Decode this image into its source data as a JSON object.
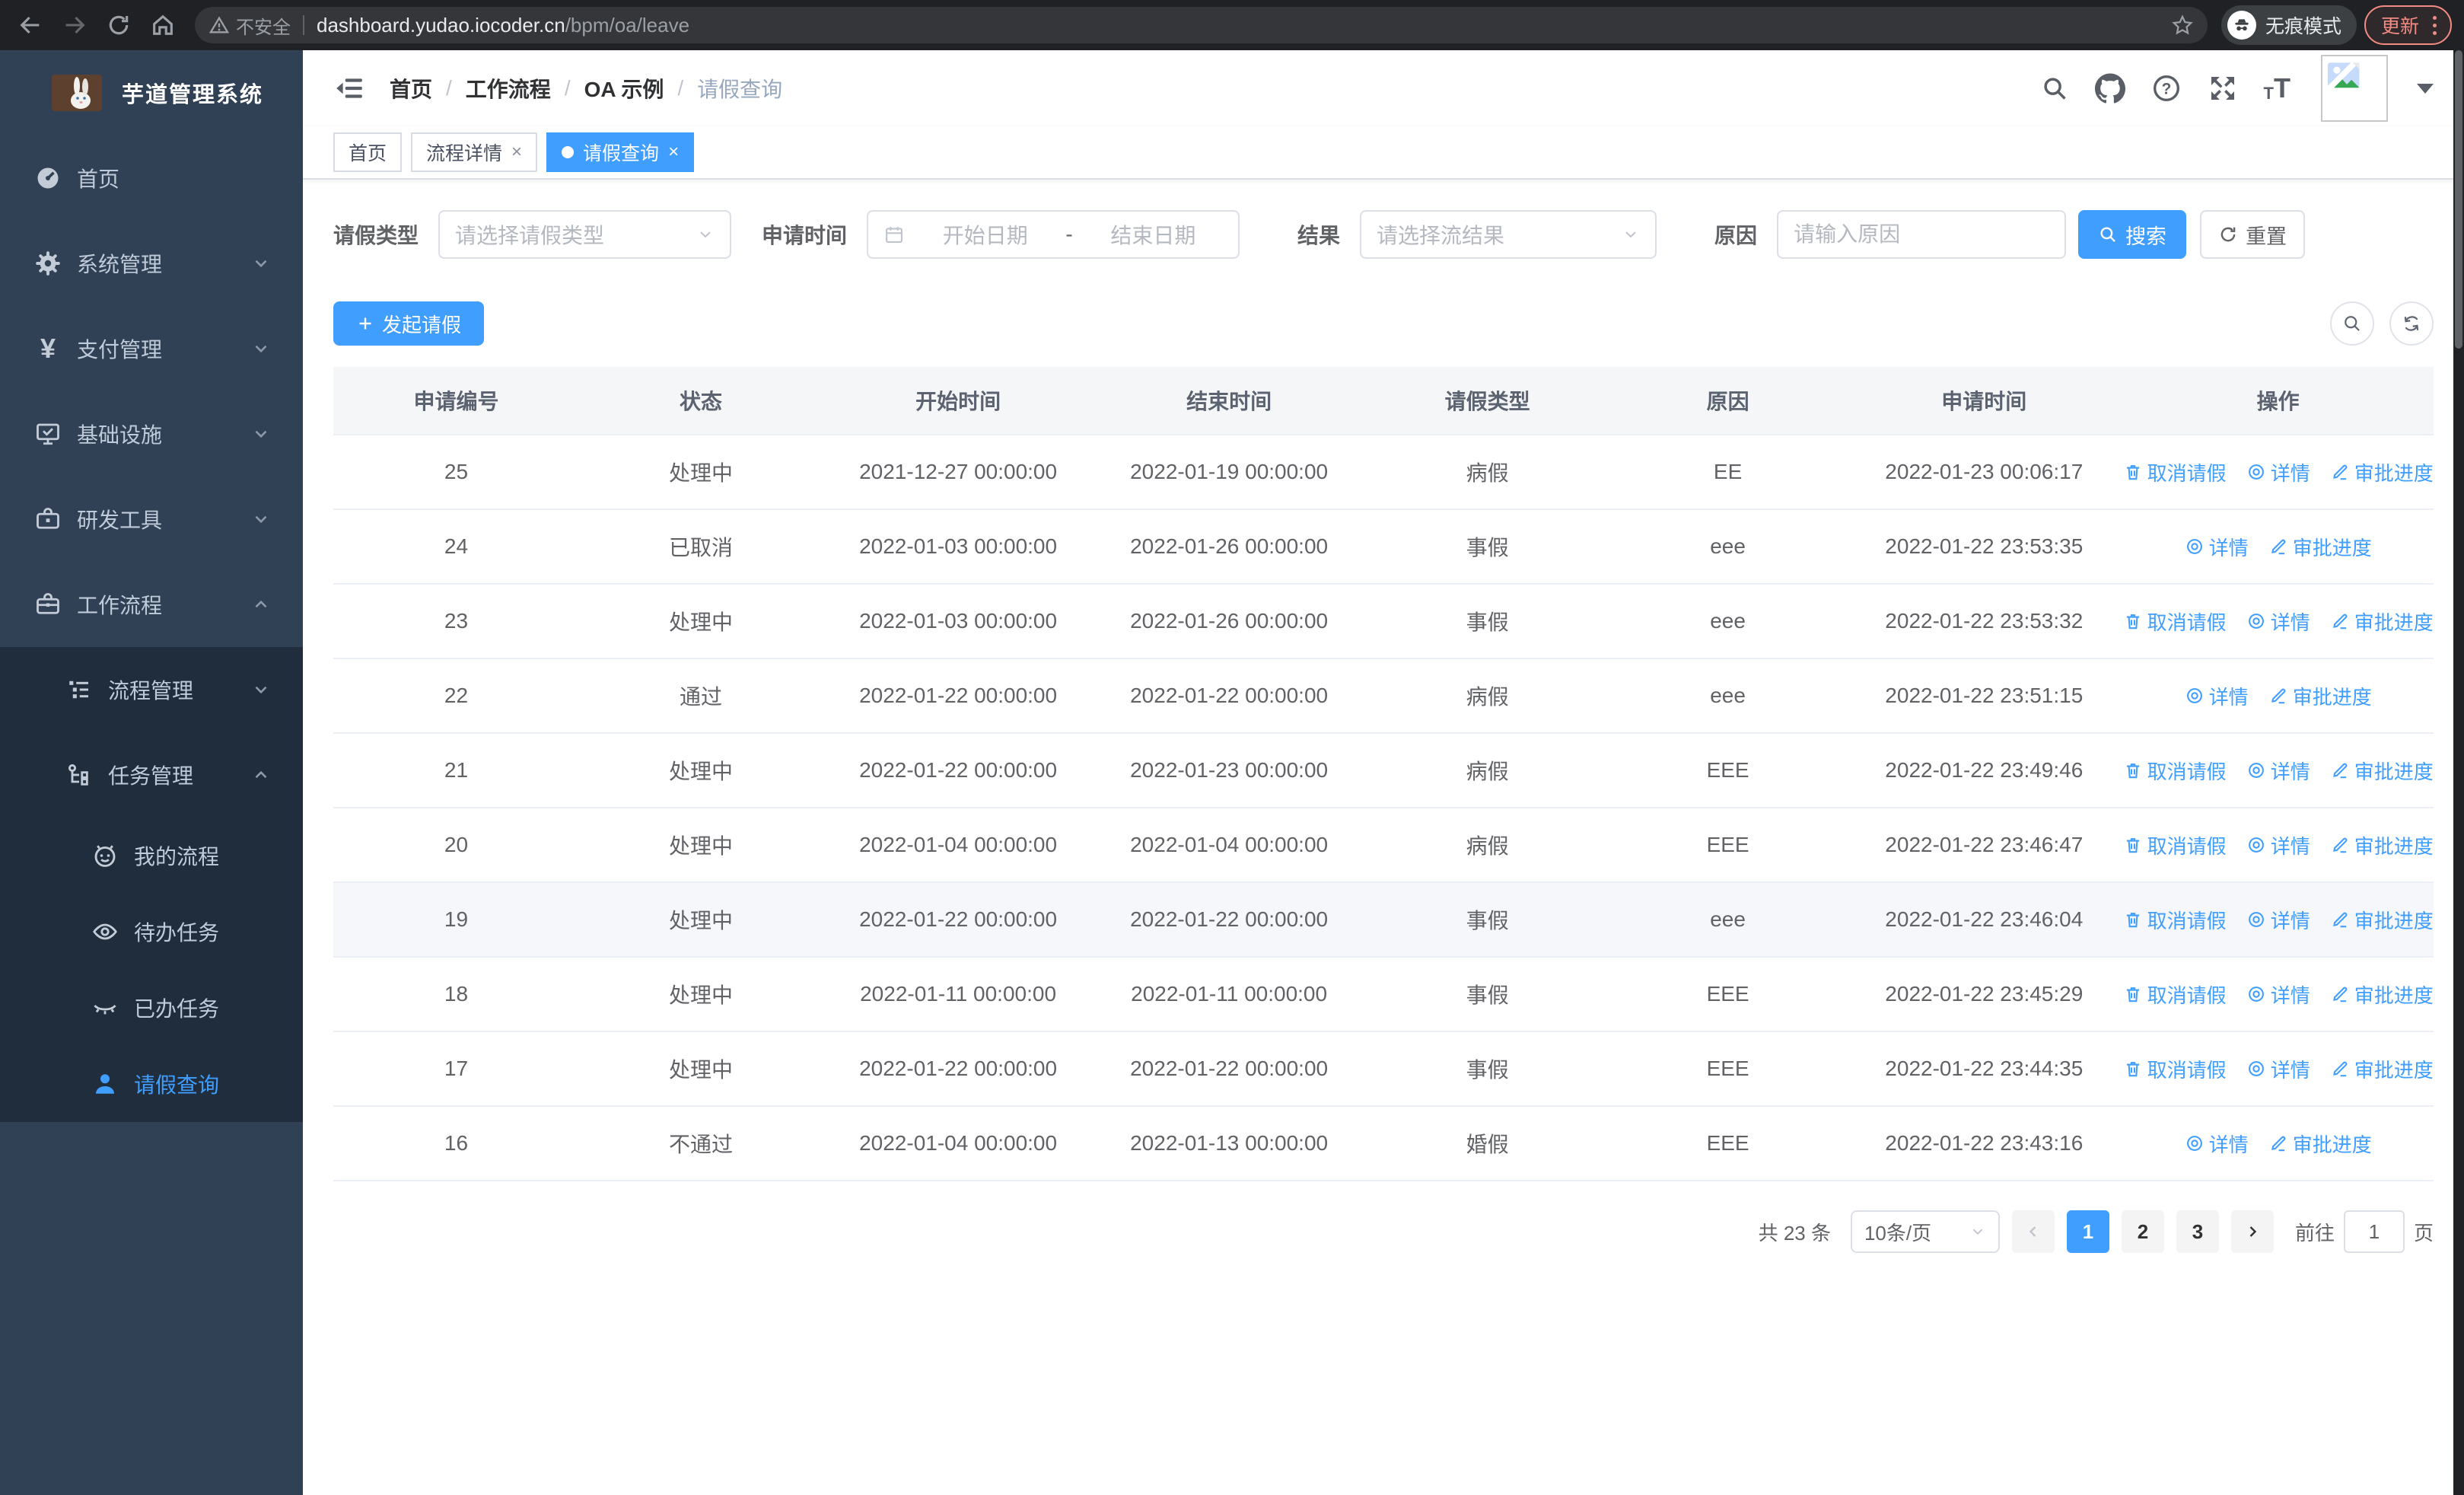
{
  "browser": {
    "insecure_label": "不安全",
    "url_host": "dashboard.yudao.iocoder.cn",
    "url_path": "/bpm/oa/leave",
    "incognito_label": "无痕模式",
    "update_label": "更新"
  },
  "sidebar": {
    "title": "芋道管理系统",
    "items": {
      "home": "首页",
      "system": "系统管理",
      "payment": "支付管理",
      "infra": "基础设施",
      "dev_tools": "研发工具",
      "workflow": "工作流程",
      "process_mgmt": "流程管理",
      "task_mgmt": "任务管理",
      "my_process": "我的流程",
      "todo_tasks": "待办任务",
      "done_tasks": "已办任务",
      "leave_query": "请假查询"
    }
  },
  "navbar": {
    "breadcrumb": [
      "首页",
      "工作流程",
      "OA 示例",
      "请假查询"
    ],
    "separator": "/"
  },
  "tabs": {
    "home": "首页",
    "process_detail": "流程详情",
    "leave_query": "请假查询"
  },
  "filters": {
    "leave_type_label": "请假类型",
    "leave_type_placeholder": "请选择请假类型",
    "apply_time_label": "申请时间",
    "start_date_placeholder": "开始日期",
    "date_separator": "-",
    "end_date_placeholder": "结束日期",
    "result_label": "结果",
    "result_placeholder": "请选择流结果",
    "reason_label": "原因",
    "reason_placeholder": "请输入原因",
    "search_label": "搜索",
    "reset_label": "重置"
  },
  "toolbar": {
    "create_label": "发起请假"
  },
  "table": {
    "columns": [
      "申请编号",
      "状态",
      "开始时间",
      "结束时间",
      "请假类型",
      "原因",
      "申请时间",
      "操作"
    ],
    "action_labels": {
      "cancel": "取消请假",
      "detail": "详情",
      "progress": "审批进度"
    },
    "rows": [
      {
        "id": "25",
        "status": "处理中",
        "start": "2021-12-27 00:00:00",
        "end": "2022-01-19 00:00:00",
        "type": "病假",
        "reason": "EE",
        "applied": "2022-01-23 00:06:17",
        "actions": [
          "cancel",
          "detail",
          "progress"
        ]
      },
      {
        "id": "24",
        "status": "已取消",
        "start": "2022-01-03 00:00:00",
        "end": "2022-01-26 00:00:00",
        "type": "事假",
        "reason": "eee",
        "applied": "2022-01-22 23:53:35",
        "actions": [
          "detail",
          "progress"
        ]
      },
      {
        "id": "23",
        "status": "处理中",
        "start": "2022-01-03 00:00:00",
        "end": "2022-01-26 00:00:00",
        "type": "事假",
        "reason": "eee",
        "applied": "2022-01-22 23:53:32",
        "actions": [
          "cancel",
          "detail",
          "progress"
        ]
      },
      {
        "id": "22",
        "status": "通过",
        "start": "2022-01-22 00:00:00",
        "end": "2022-01-22 00:00:00",
        "type": "病假",
        "reason": "eee",
        "applied": "2022-01-22 23:51:15",
        "actions": [
          "detail",
          "progress"
        ]
      },
      {
        "id": "21",
        "status": "处理中",
        "start": "2022-01-22 00:00:00",
        "end": "2022-01-23 00:00:00",
        "type": "病假",
        "reason": "EEE",
        "applied": "2022-01-22 23:49:46",
        "actions": [
          "cancel",
          "detail",
          "progress"
        ]
      },
      {
        "id": "20",
        "status": "处理中",
        "start": "2022-01-04 00:00:00",
        "end": "2022-01-04 00:00:00",
        "type": "病假",
        "reason": "EEE",
        "applied": "2022-01-22 23:46:47",
        "actions": [
          "cancel",
          "detail",
          "progress"
        ]
      },
      {
        "id": "19",
        "status": "处理中",
        "start": "2022-01-22 00:00:00",
        "end": "2022-01-22 00:00:00",
        "type": "事假",
        "reason": "eee",
        "applied": "2022-01-22 23:46:04",
        "actions": [
          "cancel",
          "detail",
          "progress"
        ]
      },
      {
        "id": "18",
        "status": "处理中",
        "start": "2022-01-11 00:00:00",
        "end": "2022-01-11 00:00:00",
        "type": "事假",
        "reason": "EEE",
        "applied": "2022-01-22 23:45:29",
        "actions": [
          "cancel",
          "detail",
          "progress"
        ]
      },
      {
        "id": "17",
        "status": "处理中",
        "start": "2022-01-22 00:00:00",
        "end": "2022-01-22 00:00:00",
        "type": "事假",
        "reason": "EEE",
        "applied": "2022-01-22 23:44:35",
        "actions": [
          "cancel",
          "detail",
          "progress"
        ]
      },
      {
        "id": "16",
        "status": "不通过",
        "start": "2022-01-04 00:00:00",
        "end": "2022-01-13 00:00:00",
        "type": "婚假",
        "reason": "EEE",
        "applied": "2022-01-22 23:43:16",
        "actions": [
          "detail",
          "progress"
        ]
      }
    ]
  },
  "pagination": {
    "total": "共 23 条",
    "page_size": "10条/页",
    "pages": [
      "1",
      "2",
      "3"
    ],
    "current": "1",
    "goto_label": "前往",
    "goto_value": "1",
    "page_unit": "页"
  },
  "colors": {
    "primary": "#409eff",
    "sidebar_bg": "#304156",
    "submenu_bg": "#1f2d3d",
    "chrome_bg": "#202124",
    "update_accent": "#f28b82"
  }
}
